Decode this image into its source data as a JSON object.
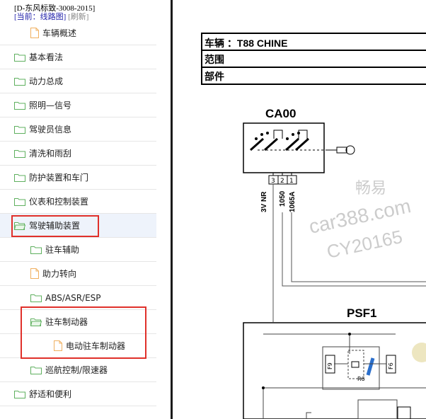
{
  "header": {
    "model": "[D-东风标致-3008-2015]",
    "current": "[当前：线路图]",
    "refresh": "[刷新]"
  },
  "tree": {
    "items": [
      {
        "label": "车辆概述",
        "icon": "file-icon"
      },
      {
        "label": "基本看法",
        "icon": "folder-icon"
      },
      {
        "label": "动力总成",
        "icon": "folder-icon"
      },
      {
        "label": "照明—信号",
        "icon": "folder-icon"
      },
      {
        "label": "驾驶员信息",
        "icon": "folder-icon"
      },
      {
        "label": "清洗和雨刮",
        "icon": "folder-icon"
      },
      {
        "label": "防护装置和车门",
        "icon": "folder-icon"
      },
      {
        "label": "仪表和控制装置",
        "icon": "folder-icon"
      },
      {
        "label": "驾驶辅助装置",
        "icon": "folder-open-icon",
        "selected": true
      },
      {
        "label": "驻车辅助",
        "icon": "folder-icon"
      },
      {
        "label": "助力转向",
        "icon": "file-icon"
      },
      {
        "label": "ABS/ASR/ESP",
        "icon": "folder-icon"
      },
      {
        "label": "驻车制动器",
        "icon": "folder-open-icon"
      },
      {
        "label": "电动驻车制动器",
        "icon": "file-icon"
      },
      {
        "label": "巡航控制/限速器",
        "icon": "folder-icon"
      },
      {
        "label": "舒适和便利",
        "icon": "folder-icon"
      }
    ]
  },
  "diagram": {
    "table": {
      "vehicle": "车辆 ：T88 CHINE",
      "range": "范围",
      "part": "部件"
    },
    "component_top": "CA00",
    "pins": [
      "3",
      "2",
      "1"
    ],
    "wires": [
      "3V NR",
      "1050",
      "1065A"
    ],
    "component_bottom": "PSF1",
    "labels": [
      "F9",
      "R6",
      "F6"
    ],
    "watermark": [
      "畅易",
      "car388.com",
      "CY20165"
    ]
  },
  "colors": {
    "highlight": "#e0302a",
    "folder": "#5fb05f",
    "file": "#f0b060",
    "current": "#2222aa"
  }
}
